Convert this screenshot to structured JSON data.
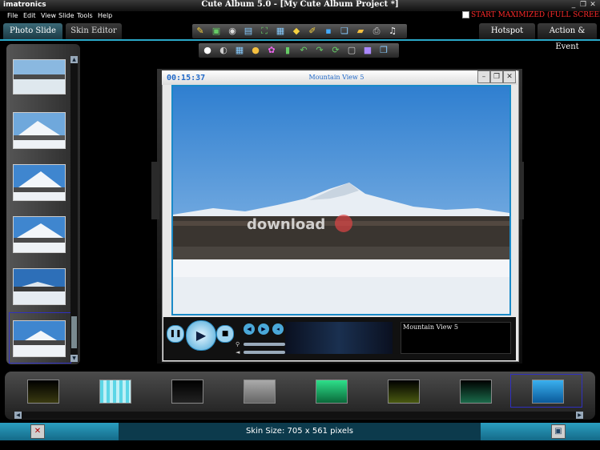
{
  "app": {
    "brand": "imatronics",
    "title": "Cute Album 5.0 - [My Cute Album Project *]"
  },
  "menu": [
    "File",
    "Edit",
    "View",
    "Slide",
    "Tools",
    "Help"
  ],
  "start_maximized": "START MAXIMIZED (FULL SCREEN)",
  "tabs": {
    "photo_slide": "Photo Slide",
    "skin_editor": "Skin Editor",
    "hotspot": "Hotspot",
    "action_event": "Action & Event"
  },
  "toolbar_top": [
    "wand-icon",
    "select-icon",
    "eye-icon",
    "page-icon",
    "fit-icon",
    "align-icon",
    "tag-icon",
    "edit-icon",
    "save-icon",
    "copy-icon",
    "folder-icon",
    "print-icon",
    "music-icon"
  ],
  "toolbar_bottom": [
    "circle-icon",
    "half-icon",
    "grid-icon",
    "dot-icon",
    "color-icon",
    "chart-icon",
    "undo-icon",
    "redo-icon",
    "refresh-icon",
    "frame-icon",
    "layer-icon",
    "stack-icon"
  ],
  "preview": {
    "timecode": "00:15:37",
    "photo_title": "Mountain View 5",
    "caption": "Mountain View 5",
    "watermark": "download"
  },
  "status": {
    "skin_size": "Skin Size: 705 x 561 pixels"
  },
  "colors": {
    "accent": "#2aa8c8",
    "status_bar": "#0f6e8c",
    "start_maximized": "#ff2a2a",
    "timecode": "#2169c8"
  }
}
